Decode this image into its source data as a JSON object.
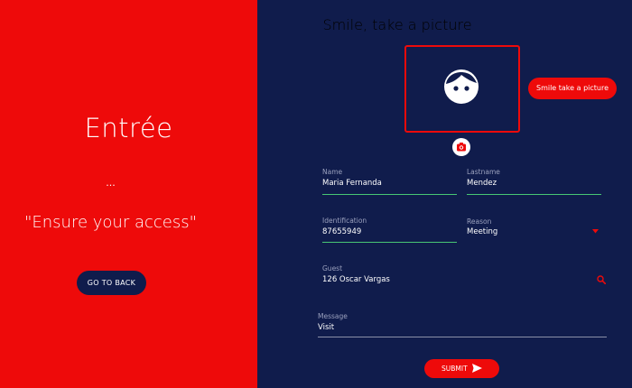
{
  "left_panel": {
    "title": "Entrée",
    "dots": "...",
    "tagline": "\"Ensure your access\"",
    "back_label": "GO TO BACK"
  },
  "right_panel": {
    "title": "Smile, take a picture",
    "smile_button": "Smile take a picture",
    "fields": {
      "name": {
        "label": "Name",
        "value": "Maria Fernanda"
      },
      "lastname": {
        "label": "Lastname",
        "value": "Mendez"
      },
      "identification": {
        "label": "Identification",
        "value": "87655949"
      },
      "reason": {
        "label": "Reason",
        "value": "Meeting"
      },
      "guest": {
        "label": "Guest",
        "value": "126 Oscar Vargas"
      },
      "message": {
        "label": "Message",
        "value": "Visit"
      }
    },
    "submit_label": "SUBMIT"
  },
  "colors": {
    "red": "#ee0a0a",
    "navy": "#101c4c",
    "green_underline": "#48c774",
    "grey_underline": "#8a90a8"
  },
  "icons": [
    "face-icon",
    "camera-icon",
    "dropdown-caret-icon",
    "search-icon",
    "send-icon"
  ]
}
